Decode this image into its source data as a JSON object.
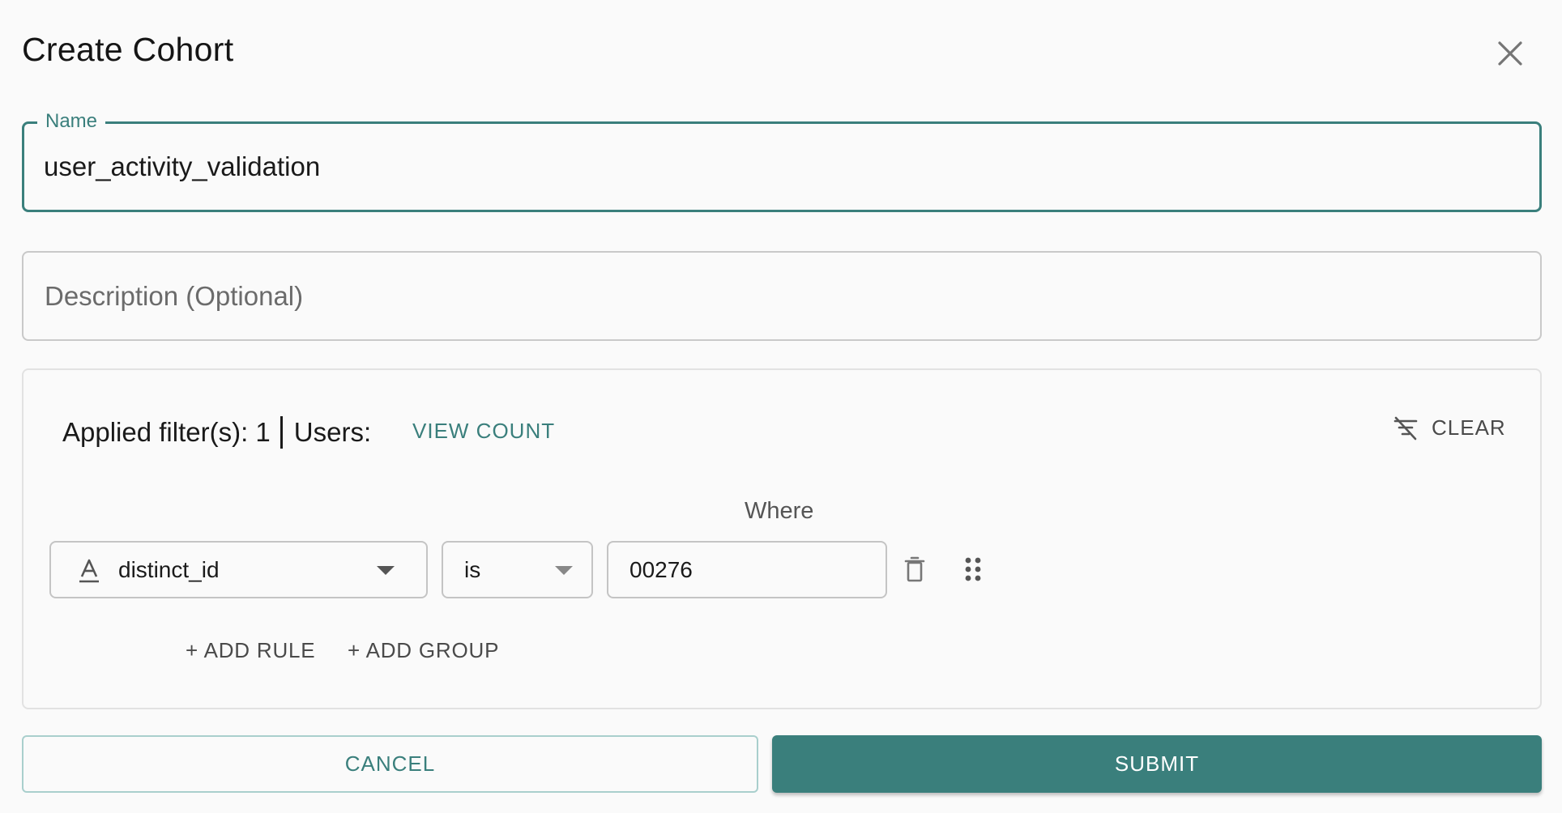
{
  "dialog": {
    "title": "Create Cohort",
    "close_icon": "close-icon"
  },
  "name_field": {
    "label": "Name",
    "value": "user_activity_validation"
  },
  "description_field": {
    "placeholder": "Description (Optional)",
    "value": ""
  },
  "filters": {
    "applied_label": "Applied filter(s): 1",
    "users_label": "Users:",
    "view_count_label": "VIEW COUNT",
    "clear_label": "CLEAR",
    "clear_icon": "filter-off-icon",
    "where_label": "Where",
    "rule": {
      "field_icon": "text-type-icon",
      "field": "distinct_id",
      "operator": "is",
      "value": "00276",
      "delete_icon": "trash-icon",
      "drag_icon": "drag-handle-icon"
    },
    "add_rule_label": "+ ADD RULE",
    "add_group_label": "+ ADD GROUP"
  },
  "footer": {
    "cancel_label": "CANCEL",
    "submit_label": "SUBMIT"
  },
  "colors": {
    "accent": "#3a7f7c",
    "background": "#fafafa"
  }
}
